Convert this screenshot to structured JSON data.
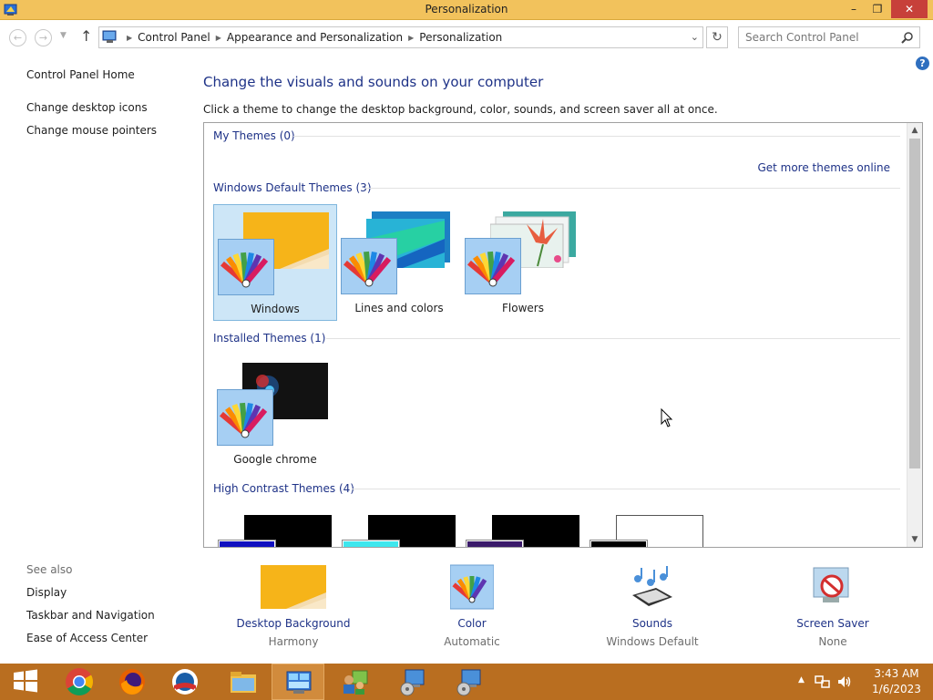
{
  "window": {
    "title": "Personalization",
    "min_label": "–",
    "max_label": "❐",
    "close_label": "✕"
  },
  "navbar": {
    "back_glyph": "←",
    "forward_glyph": "→",
    "up_glyph": "↑",
    "breadcrumbs": [
      "Control Panel",
      "Appearance and Personalization",
      "Personalization"
    ],
    "refresh_glyph": "↻",
    "search_placeholder": "Search Control Panel"
  },
  "help_label": "?",
  "left_pane": {
    "home": "Control Panel Home",
    "links": [
      "Change desktop icons",
      "Change mouse pointers"
    ],
    "see_also_heading": "See also",
    "see_also": [
      "Display",
      "Taskbar and Navigation",
      "Ease of Access Center"
    ]
  },
  "main": {
    "title": "Change the visuals and sounds on your computer",
    "description": "Click a theme to change the desktop background, color, sounds, and screen saver all at once."
  },
  "themes": {
    "my_themes_heading": "My Themes (0)",
    "more_online": "Get more themes online",
    "default_heading": "Windows Default Themes (3)",
    "default_themes": [
      {
        "name": "Windows",
        "selected": true
      },
      {
        "name": "Lines and colors",
        "selected": false
      },
      {
        "name": "Flowers",
        "selected": false
      }
    ],
    "installed_heading": "Installed Themes (1)",
    "installed_themes": [
      {
        "name": "Google chrome"
      }
    ],
    "high_contrast_heading": "High Contrast Themes (4)"
  },
  "bottom": [
    {
      "label": "Desktop Background",
      "value": "Harmony"
    },
    {
      "label": "Color",
      "value": "Automatic"
    },
    {
      "label": "Sounds",
      "value": "Windows Default"
    },
    {
      "label": "Screen Saver",
      "value": "None"
    }
  ],
  "taskbar": {
    "apps": [
      "start-button",
      "chrome-icon",
      "firefox-icon",
      "obama-logo-icon",
      "file-explorer-icon",
      "control-panel-icon",
      "network-users-icon",
      "remote-install-icon",
      "remote-install-icon-2"
    ],
    "clock_time": "3:43 AM",
    "clock_date": "1/6/2023"
  },
  "colors": {
    "title_bar": "#f2c25c",
    "taskbar": "#b96e20",
    "link_blue": "#1e3287",
    "selected_tile": "#cde6f7"
  }
}
